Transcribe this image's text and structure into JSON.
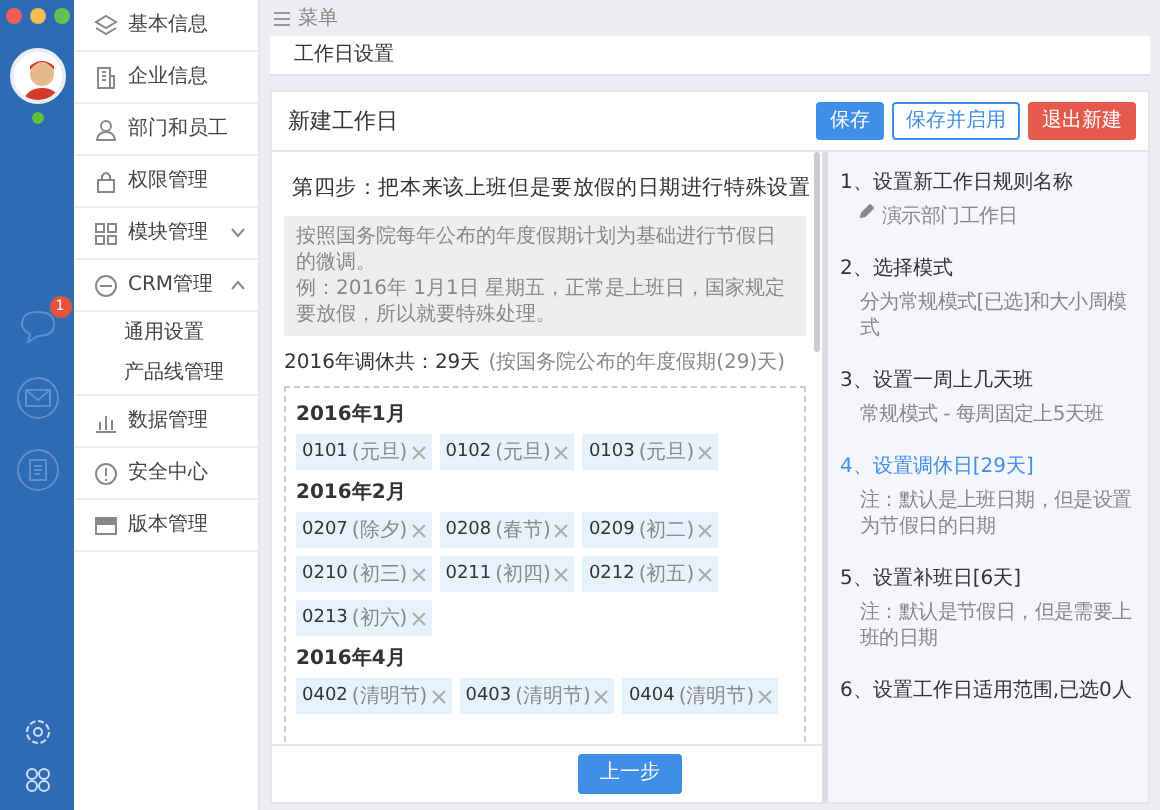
{
  "window_controls": [
    {
      "color": "#ec5f57"
    },
    {
      "color": "#f5be4f"
    },
    {
      "color": "#61c554"
    }
  ],
  "rail": {
    "online": true,
    "unread_badge": "1"
  },
  "sidebar": {
    "items": [
      {
        "label": "基本信息",
        "kind": "link"
      },
      {
        "label": "企业信息",
        "kind": "link"
      },
      {
        "label": "部门和员工",
        "kind": "link"
      },
      {
        "label": "权限管理",
        "kind": "link"
      },
      {
        "label": "模块管理",
        "kind": "group",
        "expanded": false
      },
      {
        "label": "CRM管理",
        "kind": "group",
        "expanded": true,
        "children": [
          {
            "label": "通用设置"
          },
          {
            "label": "产品线管理"
          }
        ]
      },
      {
        "label": "数据管理",
        "kind": "link"
      },
      {
        "label": "安全中心",
        "kind": "link"
      },
      {
        "label": "版本管理",
        "kind": "link"
      }
    ]
  },
  "topbar": {
    "label": "菜单"
  },
  "breadcrumb": "工作日设置",
  "card": {
    "title": "新建工作日",
    "buttons": [
      {
        "label": "保存",
        "kind": "primary"
      },
      {
        "label": "保存并启用",
        "kind": "outline"
      },
      {
        "label": "退出新建",
        "kind": "danger"
      }
    ],
    "step_heading": "第四步：把本来该上班但是要放假的日期进行特殊设置",
    "info_lines": [
      "按照国务院每年公布的年度假期计划为基础进行节假日的微调。",
      "例：2016年 1月1日 星期五，正常是上班日，国家规定要放假，所以就要特殊处理。"
    ],
    "summary": {
      "total": "2016年调休共：29天",
      "note": "(按国务院公布的年度假期(29)天)"
    },
    "months": [
      {
        "label": "2016年1月",
        "tags": [
          {
            "date": "0101",
            "note": "(元旦)"
          },
          {
            "date": "0102",
            "note": "(元旦)"
          },
          {
            "date": "0103",
            "note": "(元旦)"
          }
        ]
      },
      {
        "label": "2016年2月",
        "tags": [
          {
            "date": "0207",
            "note": "(除夕)"
          },
          {
            "date": "0208",
            "note": "(春节)"
          },
          {
            "date": "0209",
            "note": "(初二)"
          },
          {
            "date": "0210",
            "note": "(初三)"
          },
          {
            "date": "0211",
            "note": "(初四)"
          },
          {
            "date": "0212",
            "note": "(初五)"
          },
          {
            "date": "0213",
            "note": "(初六)"
          }
        ]
      },
      {
        "label": "2016年4月",
        "tags": [
          {
            "date": "0402",
            "note": "(清明节)"
          },
          {
            "date": "0403",
            "note": "(清明节)"
          },
          {
            "date": "0404",
            "note": "(清明节)"
          }
        ]
      }
    ],
    "footer_buttons": [
      {
        "label": "上一步"
      }
    ],
    "steps": [
      {
        "title": "1、设置新工作日规则名称",
        "desc": "演示部门工作日",
        "kind": "name",
        "selected": false
      },
      {
        "title": "2、选择模式",
        "desc": "分为常规模式[已选]和大小周模式",
        "kind": "text",
        "selected": false
      },
      {
        "title": "3、设置一周上几天班",
        "desc": "常规模式 - 每周固定上5天班",
        "kind": "text",
        "selected": false
      },
      {
        "title": "4、设置调休日[29天]",
        "desc": "注：默认是上班日期，但是设置为节假日的日期",
        "kind": "text",
        "selected": true
      },
      {
        "title": "5、设置补班日[6天]",
        "desc": "注：默认是节假日，但是需要上班的日期",
        "kind": "text",
        "selected": false
      },
      {
        "title": "6、设置工作日适用范围,已选0人",
        "kind": "text",
        "selected": false
      }
    ]
  }
}
